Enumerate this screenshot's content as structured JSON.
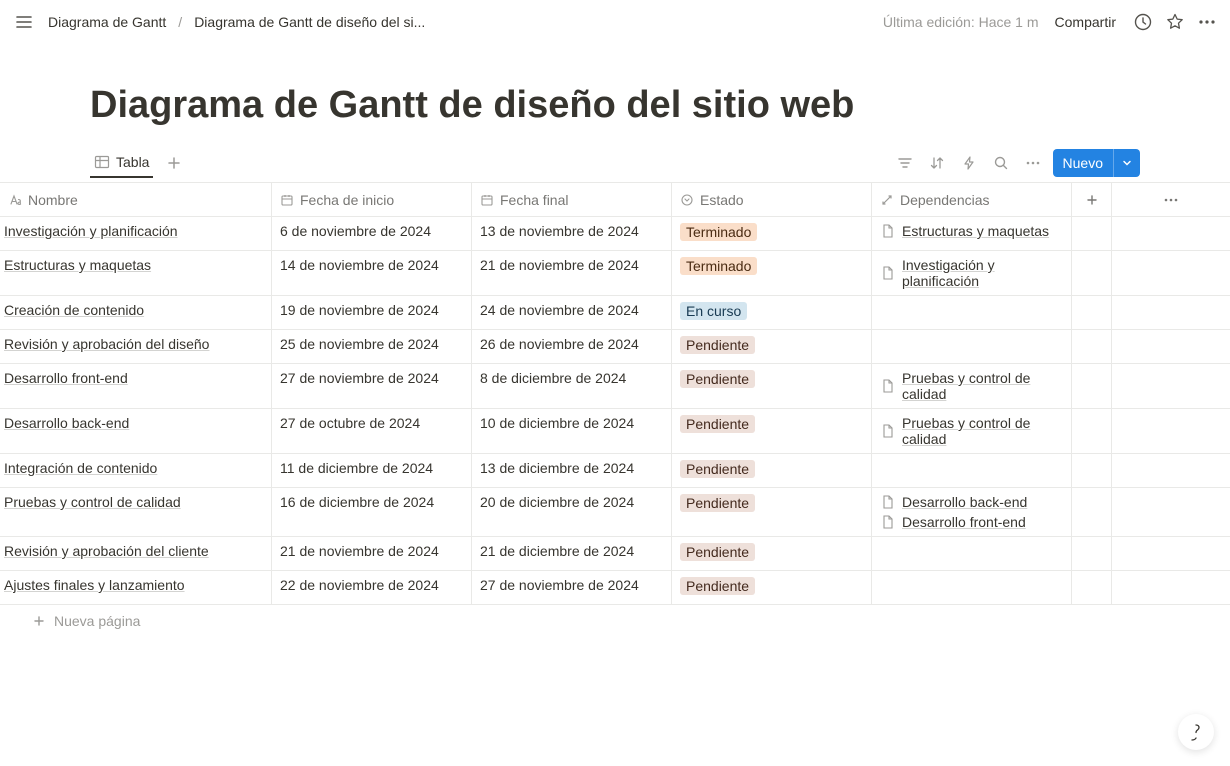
{
  "topbar": {
    "breadcrumb_parent": "Diagrama de Gantt",
    "breadcrumb_current": "Diagrama de Gantt de diseño del si...",
    "last_edit": "Última edición: Hace 1 m",
    "share": "Compartir"
  },
  "page": {
    "title": "Diagrama de Gantt de diseño del sitio web"
  },
  "views": {
    "tab_table": "Tabla",
    "new_button": "Nuevo"
  },
  "columns": {
    "name": "Nombre",
    "start": "Fecha de inicio",
    "end": "Fecha final",
    "status": "Estado",
    "deps": "Dependencias"
  },
  "status_labels": {
    "terminado": "Terminado",
    "en_curso": "En curso",
    "pendiente": "Pendiente"
  },
  "rows": [
    {
      "name": "Investigación y planificación",
      "start": "6 de noviembre de 2024",
      "end": "13 de noviembre de 2024",
      "status": "terminado",
      "deps": [
        "Estructuras y maquetas"
      ]
    },
    {
      "name": "Estructuras y maquetas",
      "start": "14 de noviembre de 2024",
      "end": "21 de noviembre de 2024",
      "status": "terminado",
      "deps": [
        "Investigación y planificación"
      ]
    },
    {
      "name": "Creación de contenido",
      "start": "19 de noviembre de 2024",
      "end": "24 de noviembre de 2024",
      "status": "en_curso",
      "deps": []
    },
    {
      "name": "Revisión y aprobación del diseño",
      "start": "25 de noviembre de 2024",
      "end": "26 de noviembre de 2024",
      "status": "pendiente",
      "deps": []
    },
    {
      "name": "Desarrollo front-end",
      "start": "27 de noviembre de 2024",
      "end": "8 de diciembre de 2024",
      "status": "pendiente",
      "deps": [
        "Pruebas y control de calidad"
      ]
    },
    {
      "name": "Desarrollo back-end",
      "start": "27 de octubre de 2024",
      "end": "10 de diciembre de 2024",
      "status": "pendiente",
      "deps": [
        "Pruebas y control de calidad"
      ]
    },
    {
      "name": "Integración de contenido",
      "start": "11 de diciembre de 2024",
      "end": "13 de diciembre de 2024",
      "status": "pendiente",
      "deps": []
    },
    {
      "name": "Pruebas y control de calidad",
      "start": "16 de diciembre de 2024",
      "end": "20 de diciembre de 2024",
      "status": "pendiente",
      "deps": [
        "Desarrollo back-end",
        "Desarrollo front-end"
      ]
    },
    {
      "name": "Revisión y aprobación del cliente",
      "start": "21 de noviembre de 2024",
      "end": "21 de diciembre de 2024",
      "status": "pendiente",
      "deps": []
    },
    {
      "name": "Ajustes finales y lanzamiento",
      "start": "22 de noviembre de 2024",
      "end": "27 de noviembre de 2024",
      "status": "pendiente",
      "deps": []
    }
  ],
  "footer": {
    "new_page": "Nueva página"
  }
}
